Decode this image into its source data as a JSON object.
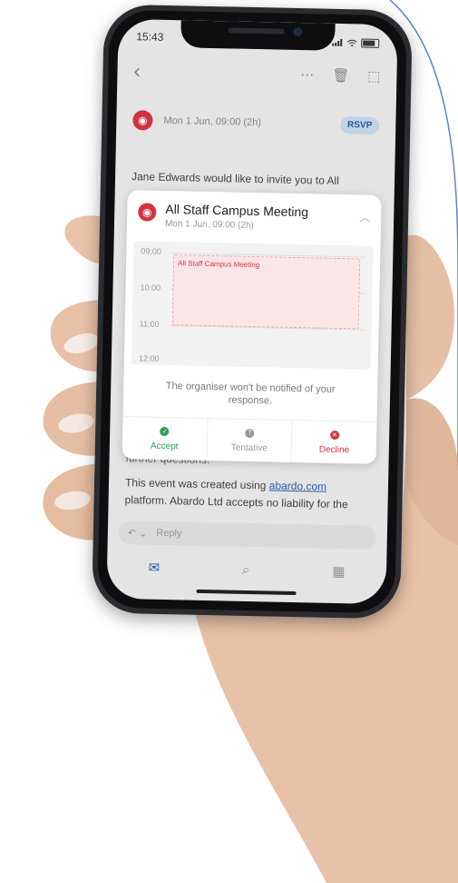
{
  "status_bar": {
    "time": "15:43"
  },
  "toolbar": {
    "back_icon": "chevron-left-icon",
    "more_icon": "ellipsis-icon",
    "delete_icon": "trash-icon",
    "archive_icon": "archive-icon"
  },
  "message": {
    "date": "Mon 1 Jun, 09:00 (2h)",
    "rsvp_label": "RSVP",
    "invite_text": "Jane Edwards would like to invite you to All"
  },
  "event_card": {
    "title": "All Staff Campus Meeting",
    "subtitle": "Mon 1 Jun, 09:00 (2h)",
    "hours": [
      "09:00",
      "10:00",
      "11:00",
      "12:00"
    ],
    "event_label": "All Staff Campus Meeting",
    "notice": "The organiser won't be notified of your response.",
    "actions": {
      "accept": "Accept",
      "tentative": "Tentative",
      "decline": "Decline"
    }
  },
  "body": {
    "partial_line": "further questions.",
    "line1_prefix": "This event was created using ",
    "link_text": "abardo.com",
    "line2": "platform. Abardo Ltd accepts no liability for the"
  },
  "reply": {
    "label": "Reply"
  },
  "colors": {
    "accent_red": "#d6343d",
    "accent_blue": "#2b5fae",
    "accept_green": "#2f9e4e"
  }
}
